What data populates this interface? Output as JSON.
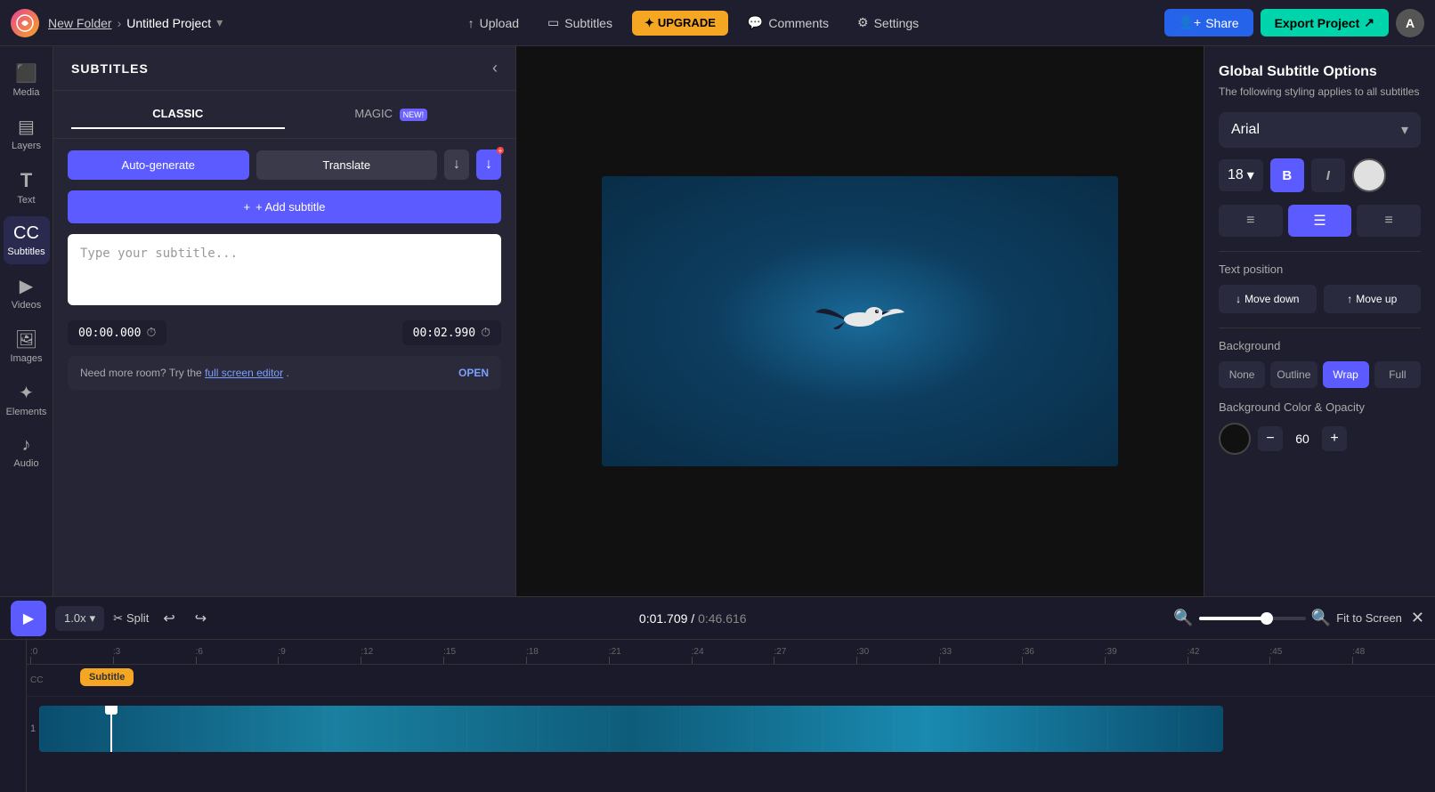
{
  "topbar": {
    "folder_name": "New Folder",
    "project_name": "Untitled Project",
    "upload_label": "Upload",
    "subtitles_label": "Subtitles",
    "upgrade_label": "UPGRADE",
    "upgrade_star": "✦",
    "comments_label": "Comments",
    "settings_label": "Settings",
    "share_label": "Share",
    "export_label": "Export Project",
    "avatar_label": "A"
  },
  "sidebar": {
    "items": [
      {
        "id": "media",
        "label": "Media",
        "icon": "⬛"
      },
      {
        "id": "layers",
        "label": "Layers",
        "icon": "▤"
      },
      {
        "id": "text",
        "label": "Text",
        "icon": "T"
      },
      {
        "id": "subtitles",
        "label": "Subtitles",
        "icon": "CC"
      },
      {
        "id": "videos",
        "label": "Videos",
        "icon": "▶"
      },
      {
        "id": "images",
        "label": "Images",
        "icon": "🖼"
      },
      {
        "id": "elements",
        "label": "Elements",
        "icon": "✦"
      },
      {
        "id": "audio",
        "label": "Audio",
        "icon": "♪"
      }
    ]
  },
  "subtitles_panel": {
    "title": "SUBTITLES",
    "tab_classic": "CLASSIC",
    "tab_magic": "MAGIC",
    "new_badge": "NEW!",
    "btn_auto": "Auto-generate",
    "btn_translate": "Translate",
    "btn_add": "+ Add subtitle",
    "textarea_placeholder": "Type your subtitle...",
    "time_start": "00:00.000",
    "time_end": "00:02.990",
    "hint_text": "Need more room? Try the ",
    "hint_link": "full screen editor",
    "hint_after": ".",
    "open_label": "OPEN"
  },
  "right_panel": {
    "title": "Global Subtitle Options",
    "subtitle": "The following styling applies to all subtitles",
    "font_name": "Arial",
    "font_size": "18",
    "bold_label": "B",
    "italic_label": "I",
    "text_position_label": "Text position",
    "move_down_label": "Move down",
    "move_up_label": "Move up",
    "background_label": "Background",
    "bg_none": "None",
    "bg_outline": "Outline",
    "bg_wrap": "Wrap",
    "bg_full": "Full",
    "bg_color_label": "Background Color & Opacity",
    "opacity_value": "60"
  },
  "timeline": {
    "speed": "1.0x",
    "split_label": "Split",
    "current_time": "0:01.709",
    "divider": "/",
    "total_time": "0:46.616",
    "fit_screen_label": "Fit to Screen",
    "ruler_marks": [
      ":0",
      ":3",
      ":6",
      ":9",
      ":12",
      ":15",
      ":18",
      ":21",
      ":24",
      ":27",
      ":30",
      ":33",
      ":36",
      ":39",
      ":42",
      ":45",
      ":48"
    ],
    "subtitle_chip_label": "Subtitle",
    "track_number": "1"
  }
}
